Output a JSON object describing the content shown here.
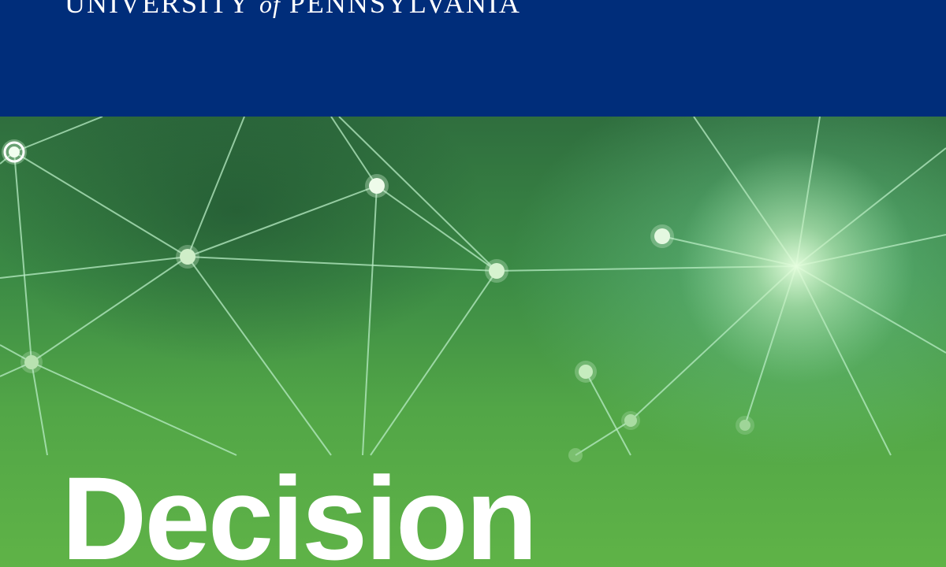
{
  "header": {
    "wordmark_university": "University",
    "wordmark_of": "of",
    "wordmark_pennsylvania": "Pennsylvania"
  },
  "hero": {
    "title": "Decision"
  },
  "colors": {
    "header_bg": "#002d7a",
    "hero_green_dark": "#2f6e3e",
    "hero_green_light": "#5fb347",
    "title_text": "#ffffff"
  },
  "icons": [
    "network-graph-illustration",
    "glow-node-icon"
  ]
}
